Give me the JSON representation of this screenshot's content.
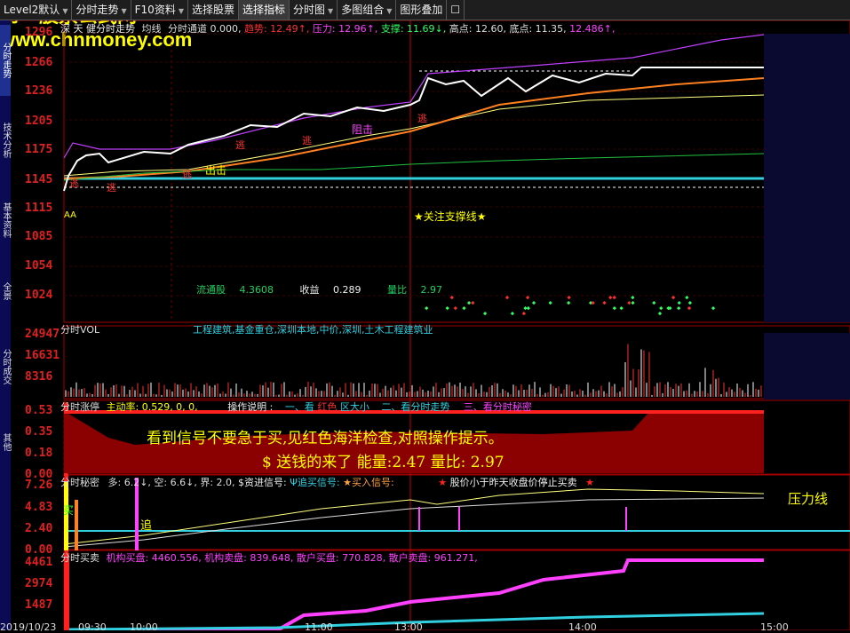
{
  "toolbar": {
    "items": [
      {
        "label": "Level2默认",
        "dd": true
      },
      {
        "label": "分时走势",
        "dd": true
      },
      {
        "label": "F10资料",
        "dd": true
      },
      {
        "label": "选择股票",
        "dd": false
      },
      {
        "label": "选择指标",
        "dd": false
      },
      {
        "label": "分时图",
        "dd": true
      },
      {
        "label": "多图组合",
        "dd": true
      },
      {
        "label": "图形叠加",
        "dd": false
      }
    ],
    "dd_glyph": "▼",
    "checkbox": "☐"
  },
  "sidetabs": [
    "分时走势",
    "技术分析",
    "基本资料",
    "全景",
    "分时成交",
    "其他"
  ],
  "main": {
    "header": {
      "name": "深 天 健分时走势",
      "avg_label": "均线",
      "channel": "分时通道 0.000,",
      "trend": "趋势: 12.49↑,",
      "pressure": "压力: 12.96↑,",
      "support": "支撑: 11.69↓,",
      "high": "高点: 12.60,",
      "low": "底点: 11.35,",
      "last": "12.486↑,"
    },
    "y_ticks": [
      "1296",
      "1266",
      "1236",
      "1205",
      "1175",
      "1145",
      "1115",
      "1085",
      "1054",
      "1024"
    ],
    "labels": {
      "aa": "AA",
      "attention": "★关注支撑线★",
      "resist": "阻击",
      "out": "出击",
      "escape": "逃"
    },
    "watermark": {
      "line1": "第一股票公式网",
      "line2": "www.chnmoney.com"
    },
    "stats": {
      "float_label": "流通股",
      "float": "4.3608",
      "eps_label": "收益",
      "eps": "0.289",
      "vr_label": "量比",
      "vr": "2.97"
    }
  },
  "vol": {
    "title": "分时VOL",
    "sectors": "工程建筑,基金重仓,深圳本地,中价,深圳,土木工程建筑业",
    "y_ticks": [
      "24947",
      "16631",
      "8316"
    ]
  },
  "zhangting": {
    "title": "分时涨停",
    "activity": "主动率: 0.529, 0, 0,",
    "ops": "操作说明 :",
    "op1": "一、看",
    "op1b": "红色",
    "op1c": "区大小",
    "op2": "二、看分时走势",
    "op3": "三、看分时秘密",
    "y_ticks": [
      "0.53",
      "0.35",
      "0.18",
      "0.00"
    ],
    "msg1": "看到信号不要急于买,见红色海洋检查,对照操作提示。",
    "msg2": "$  送钱的来了 能量:2.47   量比: 2.97"
  },
  "secret": {
    "title": "分时秘密",
    "duo": "多: 6.2↓,",
    "kong": "空: 6.6↓,",
    "jie": "界: 2.0,",
    "fund": "$资进信号:",
    "chase": "Ψ追买信号:",
    "buy": "★买入信号:",
    "stop": "股价小于昨天收盘价停止买卖",
    "star": "★",
    "y_ticks": [
      "7.26",
      "4.83",
      "2.40",
      "0.00"
    ],
    "pressure_line": "压力线",
    "buy_mark": "买",
    "chase_mark": "追"
  },
  "trade": {
    "title": "分时买卖",
    "inst_buy": "机构买盘: 4460.556,",
    "inst_sell": "机构卖盘: 839.648,",
    "retail_buy": "散户买盘: 770.828,",
    "retail_sell": "散户卖盘: 961.271,",
    "y_ticks": [
      "4461",
      "2974",
      "1487"
    ]
  },
  "x_axis": [
    "2019/10/23",
    "09:30",
    "10:00",
    "11:00",
    "13:00",
    "14:00",
    "15:00"
  ],
  "colors": {
    "up": "#ff3030",
    "green": "#20d060",
    "cyan": "#30d0e0",
    "yellow": "#ffff00",
    "magenta": "#ff40ff",
    "grid": "#8b0000"
  }
}
